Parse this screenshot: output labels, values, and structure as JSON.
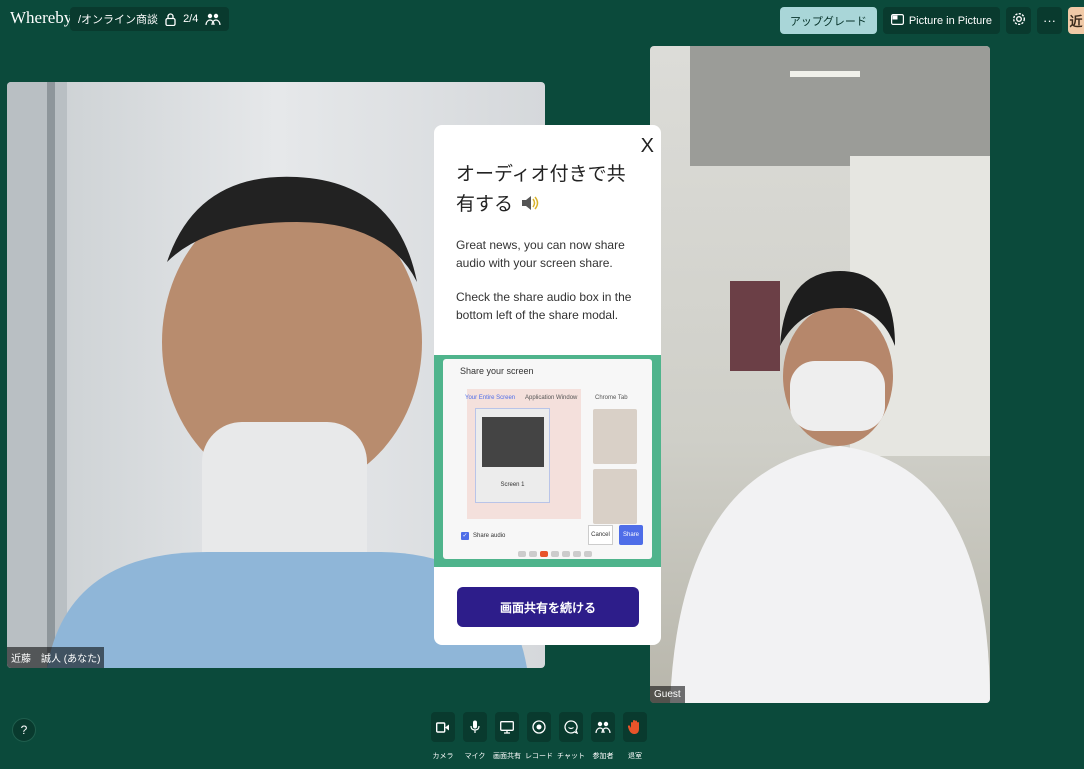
{
  "app": {
    "brand": "Whereby"
  },
  "room": {
    "name": "/オンライン商談",
    "count": "2/4"
  },
  "topbar": {
    "upgrade_label": "アップグレード",
    "pip_label": "Picture in Picture",
    "more_label": "···",
    "avatar_initial": "近"
  },
  "participants": {
    "self_name": "近藤　誠人 (あなた)",
    "guest_name": "Guest"
  },
  "modal": {
    "close_label": "X",
    "title": "オーディオ付きで共有する",
    "body1": "Great news, you can now share audio with your screen share.",
    "body2": "Check the share audio box in the bottom left of the share modal.",
    "preview": {
      "title": "Share your screen",
      "tab_entire": "Your Entire Screen",
      "tab_app": "Application Window",
      "tab_chrome": "Chrome Tab",
      "screen_label": "Screen 1",
      "share_audio": "Share audio",
      "cancel": "Cancel",
      "share": "Share"
    },
    "continue_label": "画面共有を続ける"
  },
  "help": {
    "label": "?"
  },
  "controls": [
    {
      "label": "カメラ",
      "icon": "camera-icon"
    },
    {
      "label": "マイク",
      "icon": "mic-icon"
    },
    {
      "label": "画面共有",
      "icon": "screen-share-icon"
    },
    {
      "label": "レコード",
      "icon": "record-icon"
    },
    {
      "label": "チャット",
      "icon": "chat-icon"
    },
    {
      "label": "参加者",
      "icon": "people-icon"
    },
    {
      "label": "退室",
      "icon": "leave-hand-icon"
    }
  ],
  "colors": {
    "background": "#0b4a3b",
    "upgrade": "#a9d6d8",
    "continue": "#2d1d8a",
    "accent_blue": "#4e6de8",
    "leave": "#e8542a"
  }
}
